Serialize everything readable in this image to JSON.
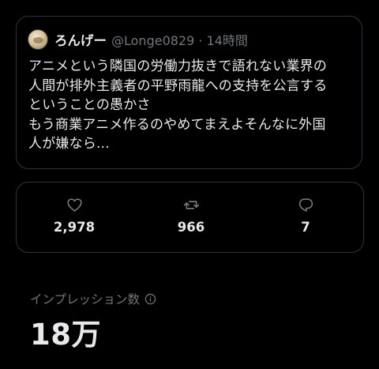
{
  "quoted_post": {
    "display_name": "ろんげー",
    "handle_time": "@Longe0829 · 14時間",
    "text_lines": [
      "アニメという隣国の労働力抜きで語れない業界の",
      "人間が排外主義者の平野雨龍への支持を公言する",
      "ということの愚かさ",
      "もう商業アニメ作るのやめてまえよそんなに外国",
      "人が嫌なら..."
    ]
  },
  "engagement": {
    "likes": "2,978",
    "retweets": "966",
    "replies": "7"
  },
  "impressions": {
    "label": "インプレッション数",
    "value": "18万"
  },
  "icons": {
    "like": "heart-icon",
    "retweet": "retweet-icon",
    "reply": "speech-bubble-icon",
    "info": "info-circle-icon"
  },
  "colors": {
    "background": "#000000",
    "text_primary": "#e7e9ea",
    "text_secondary": "#71767b",
    "border": "#2f3336"
  }
}
